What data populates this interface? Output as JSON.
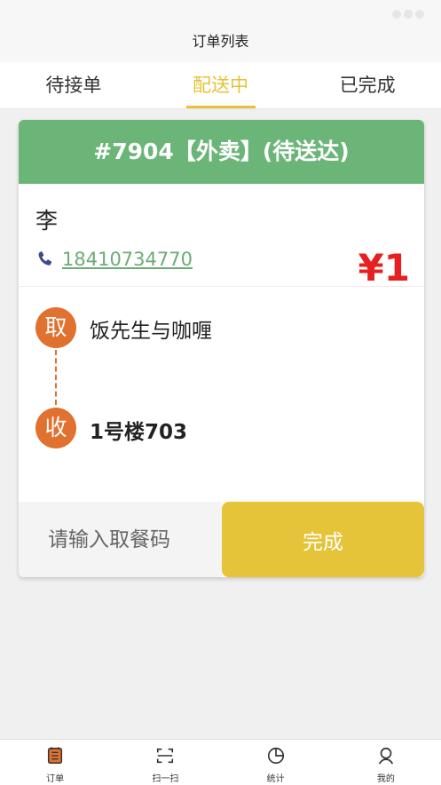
{
  "header": {
    "title": "订单列表"
  },
  "tabs": [
    {
      "label": "待接单",
      "active": false
    },
    {
      "label": "配送中",
      "active": true
    },
    {
      "label": "已完成",
      "active": false
    }
  ],
  "order": {
    "title": "#7904【外卖】(待送达)",
    "customer_name": "李",
    "phone": "18410734770",
    "price": "¥1",
    "pickup_badge": "取",
    "pickup_location": "饭先生与咖喱",
    "drop_badge": "收",
    "drop_location": "1号楼703",
    "code_placeholder": "请输入取餐码",
    "complete_label": "完成"
  },
  "nav": [
    {
      "label": "订单",
      "icon": "orders-icon"
    },
    {
      "label": "扫一扫",
      "icon": "scan-icon"
    },
    {
      "label": "统计",
      "icon": "stats-icon"
    },
    {
      "label": "我的",
      "icon": "profile-icon"
    }
  ],
  "colors": {
    "accent": "#e5c23a",
    "header_green": "#6cb579",
    "badge_orange": "#e0712f",
    "price_red": "#e62020"
  }
}
